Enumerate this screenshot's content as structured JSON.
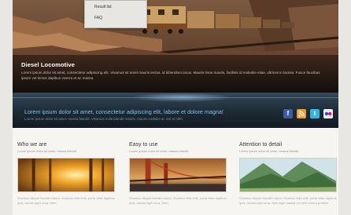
{
  "menu": {
    "items": [
      "Result list",
      "FAQ"
    ]
  },
  "hero": {
    "title": "Diesel Locomotive",
    "text": "Lorem ipsum dolor sit amet, consectetur adipiscing elit. Vivamus sit amet mauris lectus, id bibendum lacus. Mauris risus mauris, facilisis id molestie vitae, ultrices in lacinia. Fusce faucibus ipsum vel lectus dapibus viverra et ac massa."
  },
  "band": {
    "title": "Lorem ipsum dolor sit amet, consectetur adipiscing elit, labore et dolore magna!",
    "subtitle": "Lorem ipsum dolor sit amet, massa blandit. Vivamus nulla blandit mauris, mauris sodales ac nisl et nibh."
  },
  "social": [
    "facebook-icon",
    "rss-icon",
    "twitter-icon",
    "flickr-icon"
  ],
  "columns": [
    {
      "title": "Who we are",
      "subtitle": "Lorem ipsum dolor sit amet, massa blandit",
      "text": "Vivamus aliquet blandit rutrum. Vivamus felis velit, porta vitae dapibus quis, lacinia eget urna. Nam"
    },
    {
      "title": "Easy to use",
      "subtitle": "Lorem ipsum dolor sit amet, massa blandit",
      "text": "Vivamus aliquet blandit rutrum. Vivamus felis velit, porta vitae dapibus quis, lacinia eget urna. Nam"
    },
    {
      "title": "Attention to detail",
      "subtitle": "Lorem ipsum dolor sit amet, massa blandit",
      "text": "Vivamus aliquet blandit rutrum. Vivamus felis velit, porta vitae dapibus quis, lacinia eget urna. Nam eget massa vel velit viverra pretium"
    }
  ]
}
